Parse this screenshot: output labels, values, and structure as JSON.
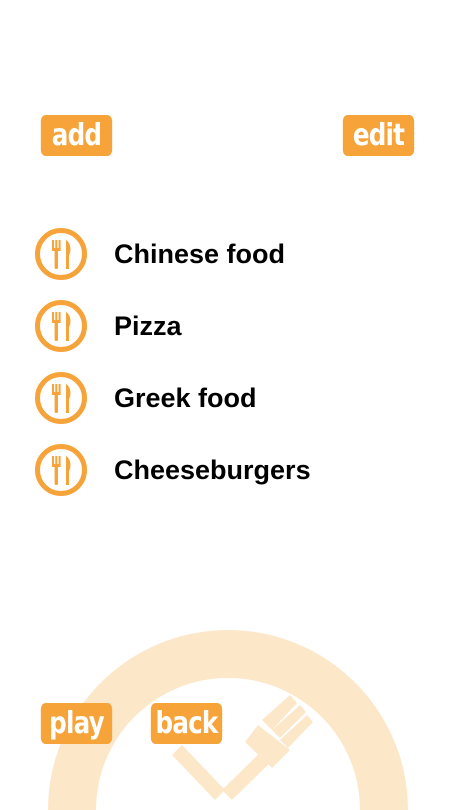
{
  "toolbar": {
    "add_label": "add",
    "edit_label": "edit"
  },
  "items": [
    {
      "label": "Chinese food",
      "icon": "fork-knife-icon"
    },
    {
      "label": "Pizza",
      "icon": "fork-knife-icon"
    },
    {
      "label": "Greek food",
      "icon": "fork-knife-icon"
    },
    {
      "label": "Cheeseburgers",
      "icon": "fork-knife-icon"
    }
  ],
  "footer": {
    "play_label": "play",
    "back_label": "back"
  },
  "colors": {
    "accent": "#f6a33a",
    "watermark": "#fde7c9",
    "text": "#000000",
    "background": "#ffffff"
  }
}
